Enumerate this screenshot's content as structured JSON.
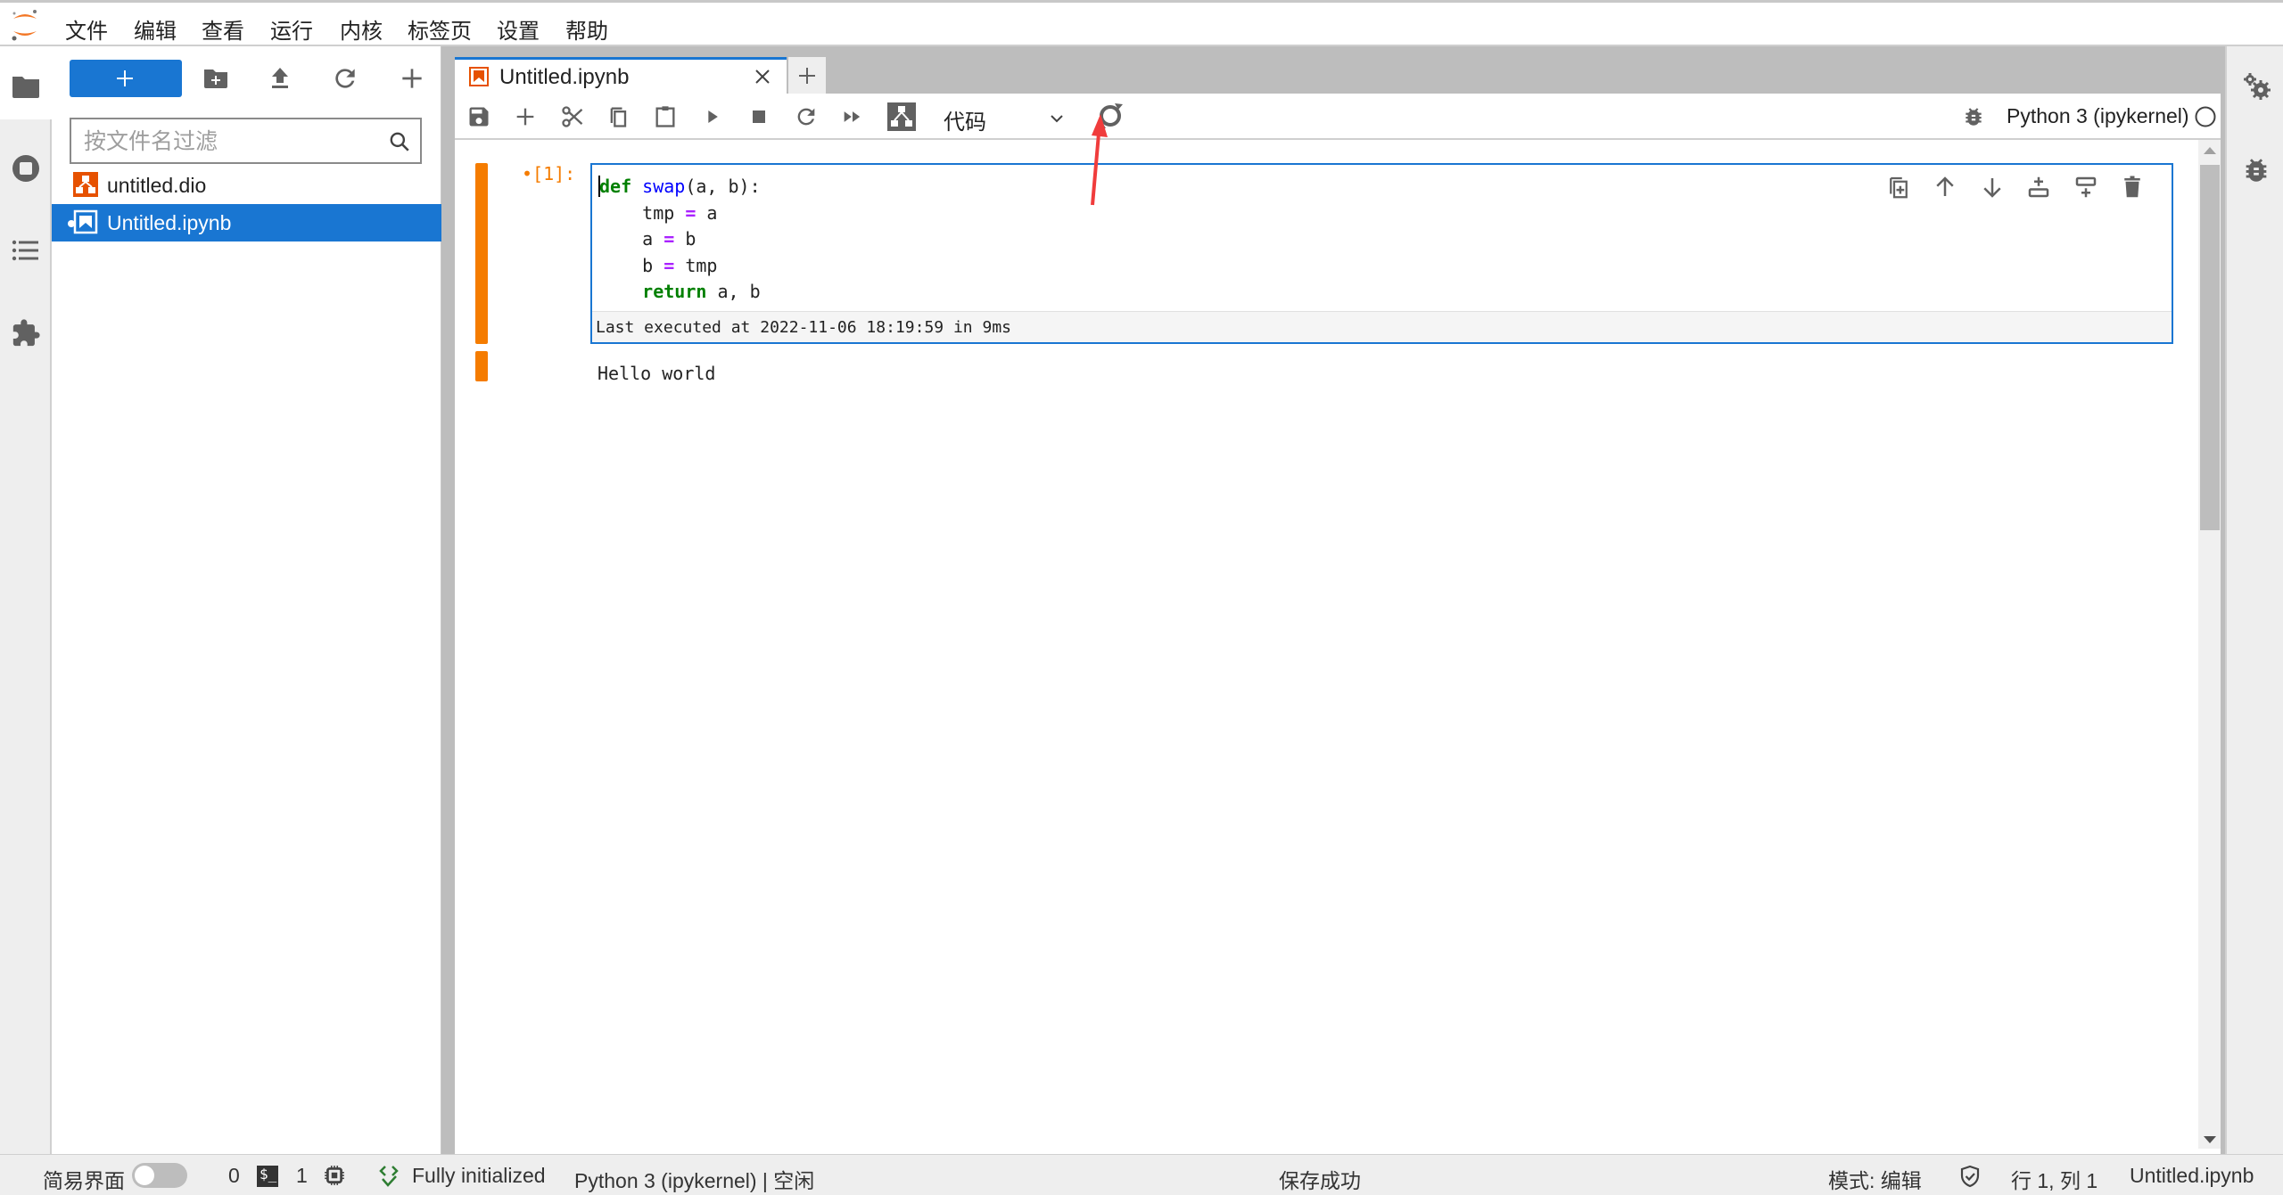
{
  "menubar": {
    "items": [
      "文件",
      "编辑",
      "查看",
      "运行",
      "内核",
      "标签页",
      "设置",
      "帮助"
    ]
  },
  "filebrowser": {
    "filter_placeholder": "按文件名过滤",
    "files": [
      {
        "name": "untitled.dio",
        "icon": "drawio-icon",
        "selected": false
      },
      {
        "name": "Untitled.ipynb",
        "icon": "notebook-icon",
        "selected": true
      }
    ]
  },
  "tabs": [
    {
      "label": "Untitled.ipynb",
      "active": true
    }
  ],
  "toolbar": {
    "cell_type": "代码",
    "kernel_name": "Python 3 (ipykernel)"
  },
  "cell": {
    "prompt": "•[1]:",
    "code": [
      [
        {
          "t": "def",
          "c": "kw"
        },
        {
          "t": " "
        },
        {
          "t": "swap",
          "c": "fn"
        },
        {
          "t": "(a, b):"
        }
      ],
      [
        {
          "t": "    tmp "
        },
        {
          "t": "=",
          "c": "op"
        },
        {
          "t": " a"
        }
      ],
      [
        {
          "t": "    a "
        },
        {
          "t": "=",
          "c": "op"
        },
        {
          "t": " b"
        }
      ],
      [
        {
          "t": "    b "
        },
        {
          "t": "=",
          "c": "op"
        },
        {
          "t": " tmp"
        }
      ],
      [
        {
          "t": "    "
        },
        {
          "t": "return",
          "c": "kw"
        },
        {
          "t": " a, b"
        }
      ]
    ],
    "exec_info": "Last executed at 2022-11-06 18:19:59 in 9ms",
    "output": "Hello world"
  },
  "statusbar": {
    "simple_mode_label": "简易界面",
    "simple_mode_on": false,
    "kernels_count": "0",
    "terminals_count": "1",
    "lsp_status": "Fully initialized",
    "kernel_status": "Python 3 (ipykernel) | 空闲",
    "save_message": "保存成功",
    "mode": "模式: 编辑",
    "cursor_position": "行 1, 列 1",
    "current_file": "Untitled.ipynb"
  },
  "colors": {
    "accent": "#1976d2",
    "cell_collapser": "#f57c00",
    "annotation_arrow": "#f03c3c"
  }
}
